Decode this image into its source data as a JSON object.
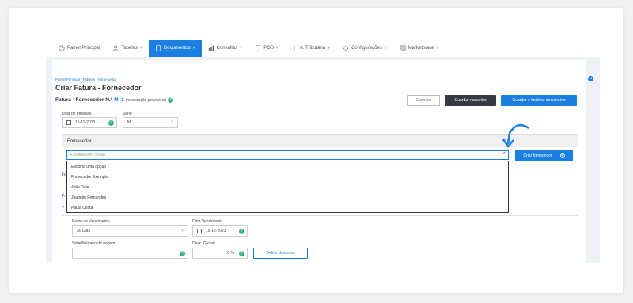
{
  "nav": {
    "items": [
      {
        "label": "Painel Principal",
        "icon": "gauge-icon"
      },
      {
        "label": "Tabelas",
        "icon": "people-icon",
        "chev": "˅"
      },
      {
        "label": "Documentos",
        "icon": "document-icon",
        "chev": "˅",
        "active": true
      },
      {
        "label": "Consultas",
        "icon": "chart-icon",
        "chev": "˅"
      },
      {
        "label": "POS",
        "icon": "pos-icon",
        "chev": "˅"
      },
      {
        "label": "A. Tributária",
        "icon": "balance-icon",
        "chev": "˅"
      },
      {
        "label": "Configurações",
        "icon": "gear-icon",
        "chev": "˅"
      },
      {
        "label": "Marketplace",
        "icon": "grid-icon",
        "chev": "˅"
      }
    ]
  },
  "breadcrumb": "Painel Principal  /  Faturas - Fornecedor",
  "page_title": "Criar Fatura - Fornecedor",
  "doc": {
    "prefix": "Fatura - Fornecedor N.º",
    "number": "M/ 1",
    "note": "(numeração provisória)"
  },
  "buttons": {
    "cancel": "Cancelar",
    "draft": "Guardar rascunho",
    "finalize": "Guardar e finalizar documento",
    "create_supplier": "Criar fornecedor",
    "set_discount": "Definir desconto"
  },
  "fields": {
    "issue_date_label": "Data de emissão",
    "issue_date": "15-11-2023",
    "series_label": "Série",
    "series": "M",
    "supplier_section": "Fornecedor",
    "supplier_placeholder": "Escolha uma opção",
    "due_term_label": "Prazo de Vencimento",
    "due_term": "30 Dias",
    "due_date_label": "Data Vencimento",
    "due_date": "15-12-2023",
    "origin_label": "Série/Número de origem",
    "discount_label": "Desc. Global",
    "discount": "0 %"
  },
  "dropdown_options": [
    "Escolha uma opção",
    "Fornecedor Exemplo",
    "João Reis",
    "Joaquim Fernandes",
    "Paula Costa"
  ],
  "partial": {
    "fe": "Fe",
    "pr": "Pr"
  },
  "colors": {
    "accent": "#1a7fe0",
    "ok": "#3bb67a",
    "dark": "#343a40"
  }
}
